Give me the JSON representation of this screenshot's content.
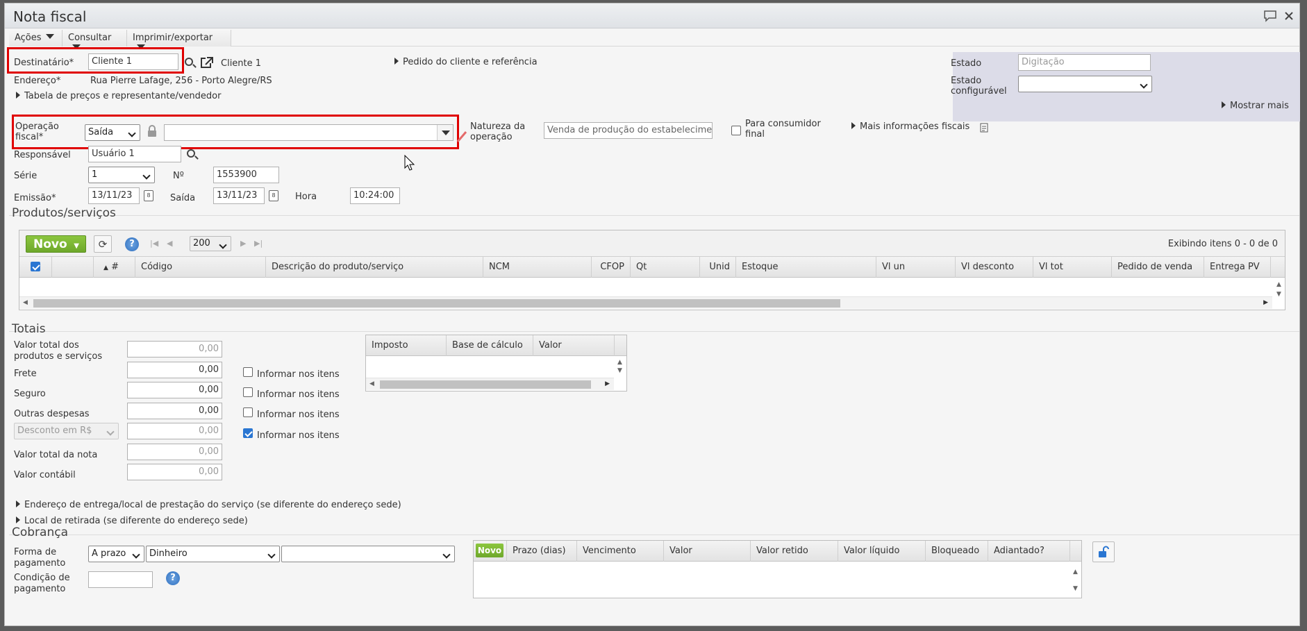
{
  "window": {
    "title": "Nota fiscal"
  },
  "menu": {
    "acoes": "Ações",
    "consultar": "Consultar",
    "imprimir": "Imprimir/exportar"
  },
  "header": {
    "destinatario_label": "Destinatário",
    "destinatario_value": "Cliente 1",
    "cliente_link": "Cliente 1",
    "pedido_link": "Pedido do cliente e referência",
    "endereco_label": "Endereço",
    "endereco_value": "Rua Pierre Lafage, 256 - Porto Alegre/RS",
    "tabela_link": "Tabela de preços e representante/vendedor",
    "operacao_label_1": "Operação",
    "operacao_label_2": "fiscal",
    "operacao_value": "Saída",
    "natureza_label_1": "Natureza da",
    "natureza_label_2": "operação",
    "natureza_value": "Venda de produção do estabelecime",
    "consumidor_label_1": "Para consumidor",
    "consumidor_label_2": "final",
    "mais_fiscais": "Mais informações fiscais",
    "responsavel_label": "Responsável",
    "responsavel_value": "Usuário 1",
    "serie_label": "Série",
    "serie_value": "1",
    "numero_label": "Nº",
    "numero_value": "1553900",
    "emissao_label": "Emissão",
    "emissao_value": "13/11/23",
    "saida_label": "Saída",
    "saida_value": "13/11/23",
    "hora_label": "Hora",
    "hora_value": "10:24:00"
  },
  "estado": {
    "estado_label": "Estado",
    "estado_value": "Digitação",
    "config_label_1": "Estado",
    "config_label_2": "configurável",
    "mostrar_mais": "Mostrar mais"
  },
  "produtos": {
    "title": "Produtos/serviços",
    "novo": "Novo",
    "page_size": "200",
    "exibindo": "Exibindo itens 0 - 0 de 0",
    "columns": [
      "#",
      "Código",
      "Descrição do produto/serviço",
      "NCM",
      "CFOP",
      "Qt",
      "Unid",
      "Estoque",
      "Vl un",
      "Vl desconto",
      "Vl tot",
      "Pedido de venda",
      "Entrega PV"
    ]
  },
  "totais": {
    "title": "Totais",
    "valor_total_label_1": "Valor total dos",
    "valor_total_label_2": "produtos e serviços",
    "valor_total_value": "0,00",
    "frete_label": "Frete",
    "frete_value": "0,00",
    "seguro_label": "Seguro",
    "seguro_value": "0,00",
    "outras_label": "Outras despesas",
    "outras_value": "0,00",
    "desconto_select": "Desconto em R$",
    "desconto_value": "0,00",
    "valor_nota_label": "Valor total da nota",
    "valor_nota_value": "0,00",
    "contabil_label": "Valor contábil",
    "contabil_value": "0,00",
    "informar": "Informar nos itens",
    "imposto_columns": [
      "Imposto",
      "Base de cálculo",
      "Valor"
    ]
  },
  "links": {
    "entrega": "Endereço de entrega/local de prestação do serviço (se diferente do endereço sede)",
    "retirada": "Local de retirada (se diferente do endereço sede)"
  },
  "cobranca": {
    "title": "Cobrança",
    "forma_label_1": "Forma de",
    "forma_label_2": "pagamento",
    "forma_value": "A prazo",
    "meio_value": "Dinheiro",
    "condicao_label_1": "Condição de",
    "condicao_label_2": "pagamento",
    "novo": "Novo",
    "columns": [
      "Prazo (dias)",
      "Vencimento",
      "Valor",
      "Valor retido",
      "Valor líquido",
      "Bloqueado",
      "Adiantado?"
    ]
  }
}
